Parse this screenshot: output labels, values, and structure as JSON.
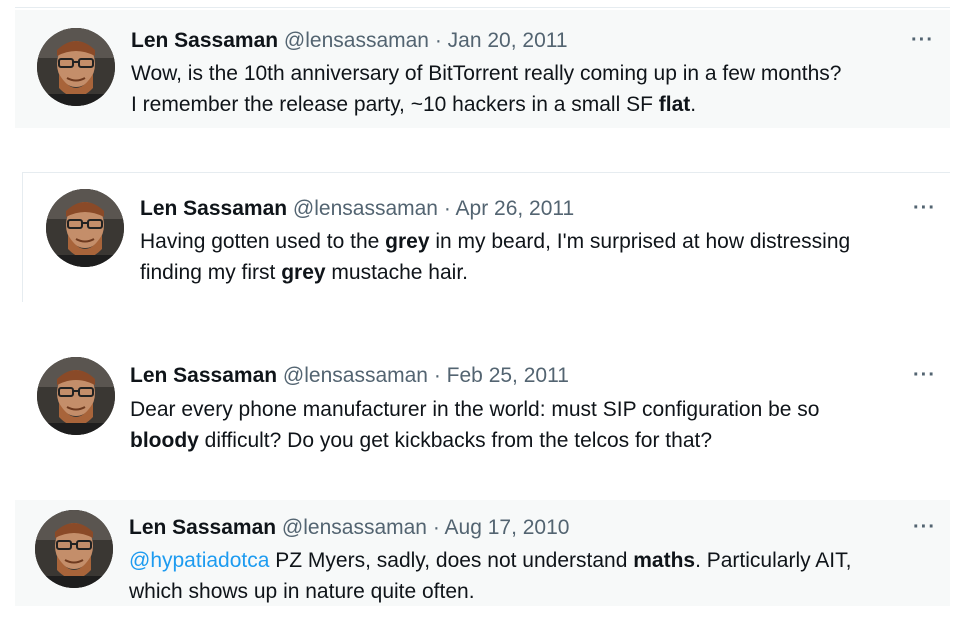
{
  "tweets": [
    {
      "author_name": "Len Sassaman",
      "handle": "@lensassaman",
      "separator": "·",
      "date": "Jan 20, 2011",
      "more_icon": "more-horizontal-icon",
      "more_label": "···",
      "lines": [
        [
          {
            "t": "Wow, is the 10th anniversary of BitTorrent really coming up in a few months?"
          }
        ],
        [
          {
            "t": "I remember the release party, ~10 hackers in a small SF "
          },
          {
            "t": "flat",
            "bold": true
          },
          {
            "t": "."
          }
        ]
      ]
    },
    {
      "author_name": "Len Sassaman",
      "handle": "@lensassaman",
      "separator": "·",
      "date": "Apr 26, 2011",
      "more_icon": "more-horizontal-icon",
      "more_label": "···",
      "lines": [
        [
          {
            "t": "Having gotten used to the "
          },
          {
            "t": "grey",
            "bold": true
          },
          {
            "t": " in my beard, I'm surprised at how distressing"
          }
        ],
        [
          {
            "t": "finding my first "
          },
          {
            "t": "grey",
            "bold": true
          },
          {
            "t": " mustache hair."
          }
        ]
      ]
    },
    {
      "author_name": "Len Sassaman",
      "handle": "@lensassaman",
      "separator": "·",
      "date": "Feb 25, 2011",
      "more_icon": "more-horizontal-icon",
      "more_label": "···",
      "lines": [
        [
          {
            "t": "Dear every phone manufacturer in the world: must SIP configuration be so"
          }
        ],
        [
          {
            "t": "bloody",
            "bold": true
          },
          {
            "t": " difficult? Do you get kickbacks from the telcos for that?"
          }
        ]
      ]
    },
    {
      "author_name": "Len Sassaman",
      "handle": "@lensassaman",
      "separator": "·",
      "date": "Aug 17, 2010",
      "more_icon": "more-horizontal-icon",
      "more_label": "···",
      "lines": [
        [
          {
            "t": "@hypatiadotca",
            "mention": true
          },
          {
            "t": " PZ Myers, sadly, does not understand "
          },
          {
            "t": "maths",
            "bold": true
          },
          {
            "t": ". Particularly AIT,"
          }
        ],
        [
          {
            "t": "which shows up in nature quite often."
          }
        ]
      ]
    }
  ],
  "colors": {
    "card_bg": "#f7f9f9",
    "secondary_text": "#536471",
    "primary_text": "#0f1419",
    "mention": "#1d9bf0"
  },
  "avatar_icon": "user-avatar-photo"
}
